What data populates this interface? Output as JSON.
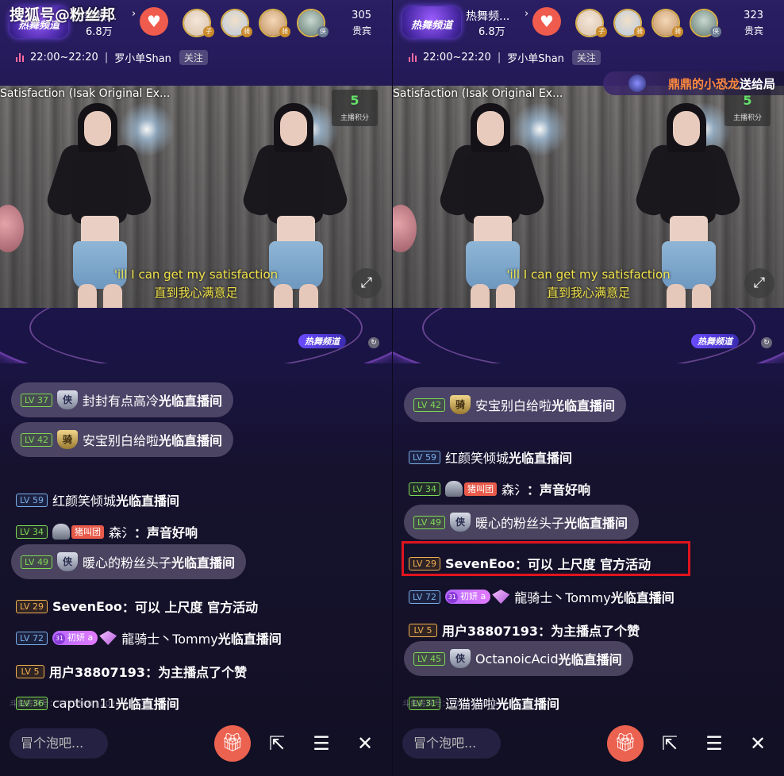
{
  "watermark": "搜狐号@粉丝邦",
  "panels": [
    {
      "channel": {
        "badge": "热舞频道",
        "name": "热舞频...",
        "fans": "6.8万"
      },
      "viewers": {
        "count": "305",
        "label": "贵宾"
      },
      "avatar_tags": [
        "子",
        "骑",
        "骑",
        "侠"
      ],
      "schedule": {
        "time": "22:00~22:20",
        "host": "罗小单Shan",
        "follow": "关注"
      },
      "gift_banner": null,
      "video": {
        "song": "Satisfaction (Isak Original Ex...",
        "score": "5",
        "score_label": "主播积分",
        "subtitle_en": "'ill I can get my satisfaction",
        "subtitle_zh": "直到我心满意足"
      },
      "stage_logo": "热舞频道",
      "chat": [
        {
          "style": "pill",
          "lv": "LV 37",
          "lvc": "green",
          "badge": "侠",
          "badge_style": "silver",
          "text": "封封有点高冷",
          "suffix": "光临直播间"
        },
        {
          "style": "pill",
          "lv": "LV 42",
          "lvc": "green",
          "badge": "骑",
          "badge_style": "gold",
          "text": "安宝别白给啦",
          "suffix": "光临直播间"
        },
        {
          "style": "plain",
          "lv": "LV 59",
          "lvc": "blue",
          "text": "红颜笑倾城",
          "suffix": "光临直播间"
        },
        {
          "style": "plain",
          "lv": "LV 34",
          "lvc": "green",
          "helmet": true,
          "team": "猪叫团",
          "text": "森氵",
          "suffix": "：声音好响"
        },
        {
          "style": "pill",
          "lv": "LV 49",
          "lvc": "green",
          "badge": "侠",
          "badge_style": "silver",
          "text": "暖心的粉丝头子",
          "suffix": "光临直播间"
        },
        {
          "style": "plain",
          "lv": "LV 29",
          "lvc": "orange",
          "text": "SevenEoo",
          "suffix": "：可以 上尺度 官方活动",
          "bold_name": true
        },
        {
          "style": "plain",
          "lv": "LV 72",
          "lvc": "blue",
          "fan": "初妍 a",
          "fan_level": "31",
          "text": "龍骑士丶Tommy",
          "suffix": "光临直播间"
        },
        {
          "style": "plain",
          "lv": "LV 5",
          "lvc": "orange",
          "text": "用户38807193",
          "suffix": "：为主播点了个赞",
          "bold_name": true
        },
        {
          "style": "plain",
          "lv": "LV 36",
          "lvc": "green",
          "text": "caption11",
          "suffix": "光临直播间"
        }
      ],
      "footer_id": "斗鱼房间号：7772548 | 2023.03.23",
      "bottom": {
        "input_placeholder": "冒个泡吧..."
      }
    },
    {
      "channel": {
        "badge": "热舞频道",
        "name": "热舞频...",
        "fans": "6.8万"
      },
      "viewers": {
        "count": "323",
        "label": "贵宾"
      },
      "avatar_tags": [
        "子",
        "骑",
        "骑",
        "侠"
      ],
      "schedule": {
        "time": "22:00~22:20",
        "host": "罗小单Shan",
        "follow": "关注"
      },
      "gift_banner": {
        "name": "鼎鼎的小恐龙",
        "action": "送给局"
      },
      "video": {
        "song": "Satisfaction (Isak Original Ex...",
        "score": "5",
        "score_label": "主播积分",
        "subtitle_en": "'ill I can get my satisfaction",
        "subtitle_zh": "直到我心满意足"
      },
      "stage_logo": "热舞频道",
      "chat": [
        {
          "style": "pill",
          "lv": "LV 42",
          "lvc": "green",
          "badge": "骑",
          "badge_style": "gold",
          "text": "安宝别白给啦",
          "suffix": "光临直播间"
        },
        {
          "style": "plain",
          "lv": "LV 59",
          "lvc": "blue",
          "text": "红颜笑倾城",
          "suffix": "光临直播间"
        },
        {
          "style": "plain",
          "lv": "LV 34",
          "lvc": "green",
          "helmet": true,
          "team": "猪叫团",
          "text": "森氵",
          "suffix": "：声音好响"
        },
        {
          "style": "pill",
          "lv": "LV 49",
          "lvc": "green",
          "badge": "侠",
          "badge_style": "silver",
          "text": "暖心的粉丝头子",
          "suffix": "光临直播间"
        },
        {
          "style": "plain",
          "lv": "LV 29",
          "lvc": "orange",
          "text": "SevenEoo",
          "suffix": "：可以 上尺度 官方活动",
          "bold_name": true
        },
        {
          "style": "plain",
          "lv": "LV 72",
          "lvc": "blue",
          "fan": "初妍 a",
          "fan_level": "31",
          "text": "龍骑士丶Tommy",
          "suffix": "光临直播间"
        },
        {
          "style": "plain",
          "lv": "LV 5",
          "lvc": "orange",
          "text": "用户38807193",
          "suffix": "：为主播点了个赞",
          "bold_name": true
        },
        {
          "style": "pill",
          "lv": "LV 45",
          "lvc": "green",
          "badge": "侠",
          "badge_style": "silver",
          "text": "OctanoicAcid",
          "suffix": "光临直播间"
        },
        {
          "style": "plain",
          "lv": "LV 31",
          "lvc": "green",
          "text": "逗猫猫啦",
          "suffix": "光临直播间"
        }
      ],
      "footer_id": "斗鱼房间号：7772548 | 2023.03.23",
      "bottom": {
        "input_placeholder": "冒个泡吧..."
      }
    }
  ]
}
